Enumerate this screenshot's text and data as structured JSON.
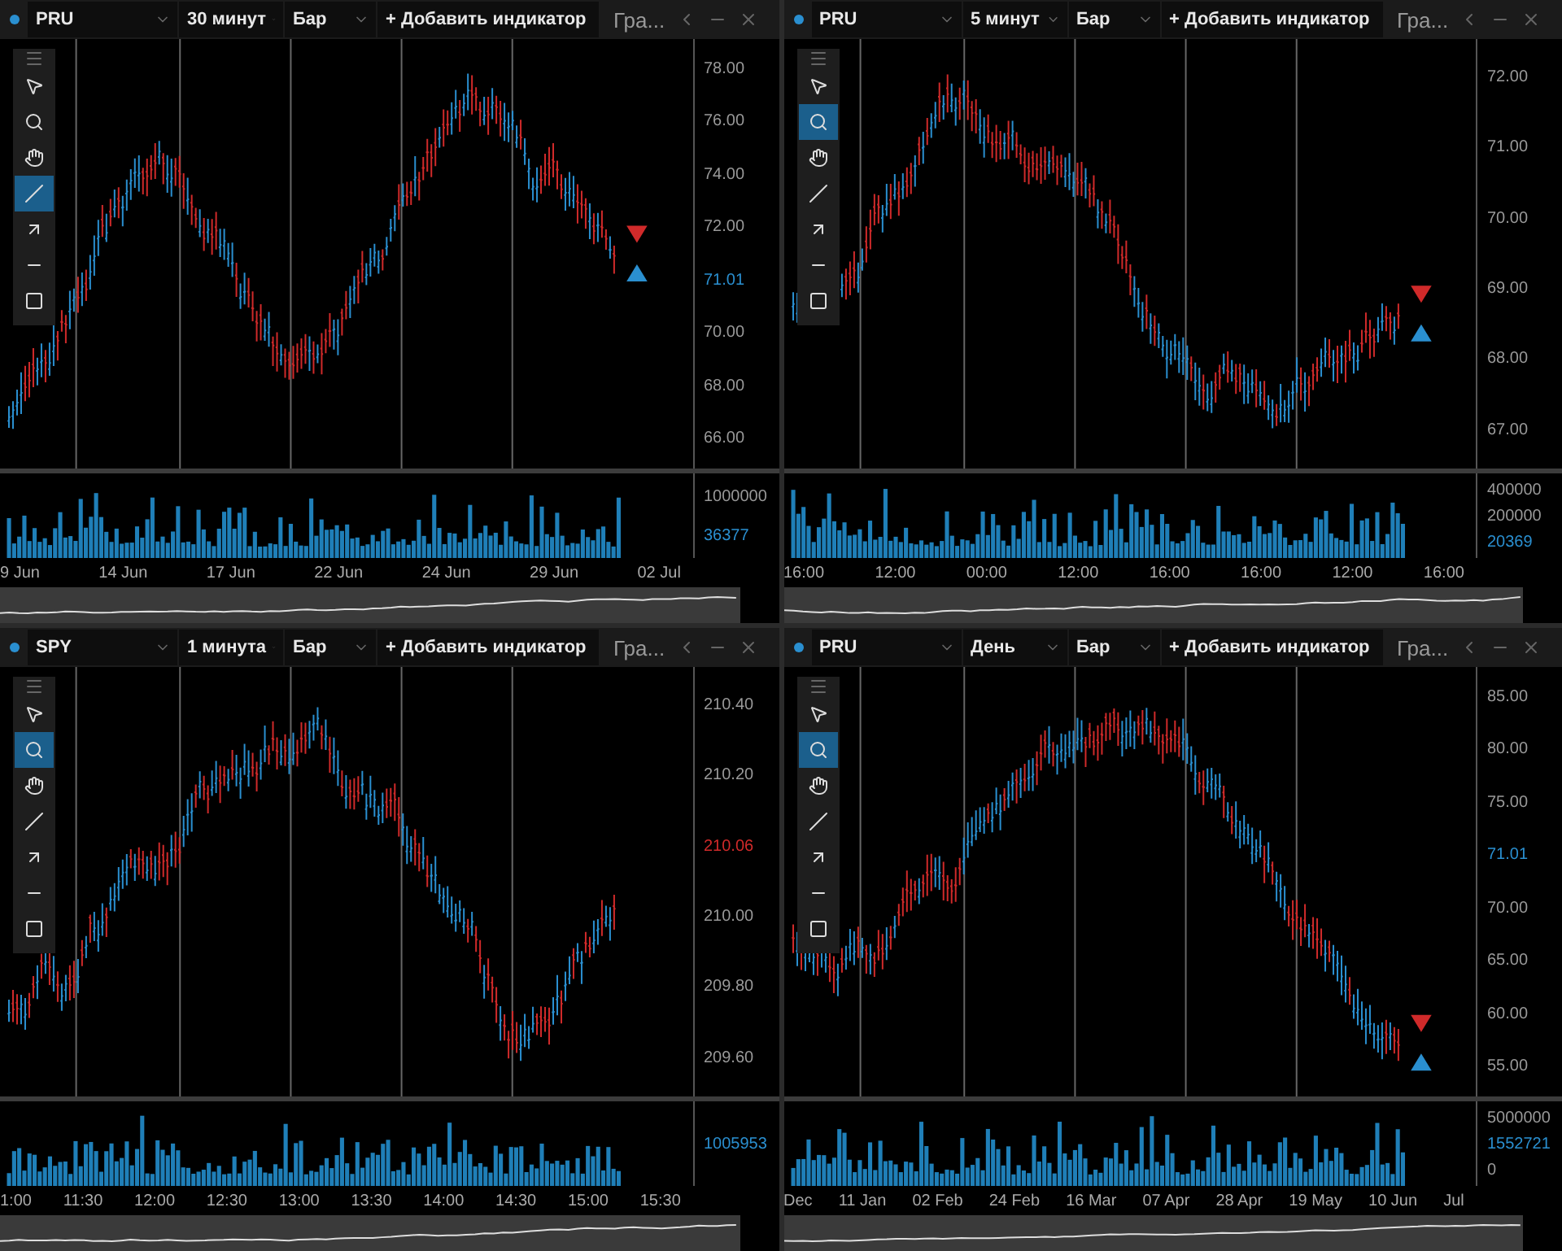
{
  "panels": [
    {
      "symbol": "PRU",
      "interval": "30 минут",
      "chart_type": "Бар",
      "add_indicator": "+ Добавить индикатор",
      "chart_tab": "Гра...",
      "tools": [
        {
          "kind": "pointer",
          "selected": false
        },
        {
          "kind": "zoom",
          "selected": false
        },
        {
          "kind": "pan",
          "selected": false
        },
        {
          "kind": "line",
          "selected": true
        },
        {
          "kind": "arrow",
          "selected": false
        },
        {
          "kind": "hline",
          "selected": false
        },
        {
          "kind": "rect",
          "selected": false
        }
      ],
      "price_labels": [
        {
          "text": "78.00",
          "kind": "tick"
        },
        {
          "text": "76.00",
          "kind": "tick"
        },
        {
          "text": "74.00",
          "kind": "tick"
        },
        {
          "text": "72.00",
          "kind": "tick"
        },
        {
          "text": "71.01",
          "kind": "last_up"
        },
        {
          "text": "70.00",
          "kind": "tick"
        },
        {
          "text": "68.00",
          "kind": "tick"
        },
        {
          "text": "66.00",
          "kind": "tick"
        }
      ],
      "volume_labels": [
        {
          "text": "1000000",
          "kind": "tick"
        },
        {
          "text": "36377",
          "kind": "last_up"
        }
      ],
      "time_labels": [
        "9 Jun",
        "14 Jun",
        "17 Jun",
        "22 Jun",
        "24 Jun",
        "29 Jun",
        "02 Jul"
      ]
    },
    {
      "symbol": "PRU",
      "interval": "5 минут",
      "chart_type": "Бар",
      "add_indicator": "+ Добавить индикатор",
      "chart_tab": "Гра...",
      "tools": [
        {
          "kind": "pointer",
          "selected": false
        },
        {
          "kind": "zoom",
          "selected": true
        },
        {
          "kind": "pan",
          "selected": false
        },
        {
          "kind": "line",
          "selected": false
        },
        {
          "kind": "arrow",
          "selected": false
        },
        {
          "kind": "hline",
          "selected": false
        },
        {
          "kind": "rect",
          "selected": false
        }
      ],
      "price_labels": [
        {
          "text": "72.00",
          "kind": "tick"
        },
        {
          "text": "71.00",
          "kind": "tick"
        },
        {
          "text": "70.00",
          "kind": "tick"
        },
        {
          "text": "69.00",
          "kind": "tick"
        },
        {
          "text": "68.00",
          "kind": "tick"
        },
        {
          "text": "67.00",
          "kind": "tick"
        }
      ],
      "volume_labels": [
        {
          "text": "400000",
          "kind": "tick"
        },
        {
          "text": "200000",
          "kind": "tick"
        },
        {
          "text": "20369",
          "kind": "last_up"
        }
      ],
      "time_labels": [
        "16:00",
        "12:00",
        "00:00",
        "12:00",
        "16:00",
        "16:00",
        "12:00",
        "16:00"
      ]
    },
    {
      "symbol": "SPY",
      "interval": "1 минута",
      "chart_type": "Бар",
      "add_indicator": "+ Добавить индикатор",
      "chart_tab": "Гра...",
      "tools": [
        {
          "kind": "pointer",
          "selected": false
        },
        {
          "kind": "zoom",
          "selected": true
        },
        {
          "kind": "pan",
          "selected": false
        },
        {
          "kind": "line",
          "selected": false
        },
        {
          "kind": "arrow",
          "selected": false
        },
        {
          "kind": "hline",
          "selected": false
        },
        {
          "kind": "rect",
          "selected": false
        }
      ],
      "price_labels": [
        {
          "text": "210.40",
          "kind": "tick"
        },
        {
          "text": "210.20",
          "kind": "tick"
        },
        {
          "text": "210.06",
          "kind": "last_down"
        },
        {
          "text": "210.00",
          "kind": "tick"
        },
        {
          "text": "209.80",
          "kind": "tick"
        },
        {
          "text": "209.60",
          "kind": "tick"
        }
      ],
      "volume_labels": [
        {
          "text": "1005953",
          "kind": "last_up"
        }
      ],
      "time_labels": [
        "1:00",
        "11:30",
        "12:00",
        "12:30",
        "13:00",
        "13:30",
        "14:00",
        "14:30",
        "15:00",
        "15:30"
      ]
    },
    {
      "symbol": "PRU",
      "interval": "День",
      "chart_type": "Бар",
      "add_indicator": "+ Добавить индикатор",
      "chart_tab": "Гра...",
      "tools": [
        {
          "kind": "pointer",
          "selected": false
        },
        {
          "kind": "zoom",
          "selected": true
        },
        {
          "kind": "pan",
          "selected": false
        },
        {
          "kind": "line",
          "selected": false
        },
        {
          "kind": "arrow",
          "selected": false
        },
        {
          "kind": "hline",
          "selected": false
        },
        {
          "kind": "rect",
          "selected": false
        }
      ],
      "price_labels": [
        {
          "text": "85.00",
          "kind": "tick"
        },
        {
          "text": "80.00",
          "kind": "tick"
        },
        {
          "text": "75.00",
          "kind": "tick"
        },
        {
          "text": "71.01",
          "kind": "last_up"
        },
        {
          "text": "70.00",
          "kind": "tick"
        },
        {
          "text": "65.00",
          "kind": "tick"
        },
        {
          "text": "60.00",
          "kind": "tick"
        },
        {
          "text": "55.00",
          "kind": "tick"
        }
      ],
      "volume_labels": [
        {
          "text": "5000000",
          "kind": "tick"
        },
        {
          "text": "1552721",
          "kind": "last_up"
        },
        {
          "text": "0",
          "kind": "tick"
        }
      ],
      "time_labels": [
        "Dec",
        "11 Jan",
        "02 Feb",
        "24 Feb",
        "16 Mar",
        "07 Apr",
        "28 Apr",
        "19 May",
        "10 Jun",
        "Jul"
      ]
    }
  ]
}
